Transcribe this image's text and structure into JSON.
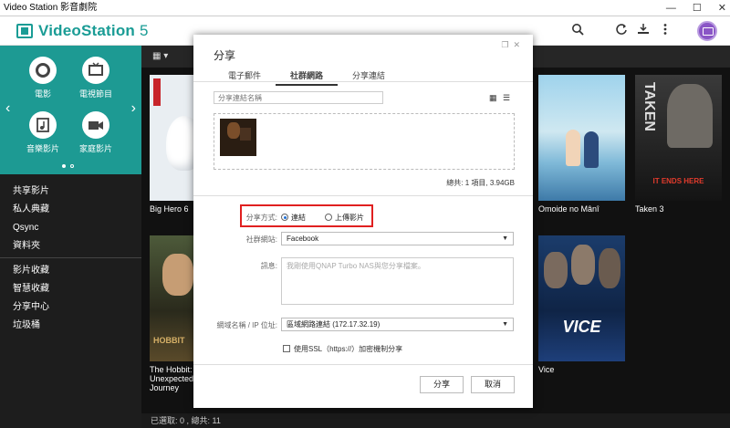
{
  "window": {
    "title": "Video Station 影音劇院",
    "controls": [
      "—",
      "☐",
      "✕"
    ]
  },
  "app": {
    "name": "VideoStation",
    "version": "5",
    "accent": "#1a9c95"
  },
  "sidebar": {
    "tiles": [
      {
        "label": "電影",
        "icon": "film-reel-icon"
      },
      {
        "label": "電視節目",
        "icon": "tv-icon"
      },
      {
        "label": "音樂影片",
        "icon": "music-note-icon"
      },
      {
        "label": "家庭影片",
        "icon": "camcorder-icon"
      }
    ],
    "section1": [
      "共享影片",
      "私人典藏",
      "Qsync",
      "資料夾"
    ],
    "section2": [
      "影片收藏",
      "智慧收藏",
      "分享中心",
      "垃圾桶"
    ]
  },
  "main": {
    "posters": [
      {
        "caption": "Big Hero 6"
      },
      {
        "caption": "Omoide no Mânî"
      },
      {
        "caption": "Taken 3"
      },
      {
        "caption": "The Hobbit: An Unexpected Journey"
      },
      {
        "caption": "Vice"
      }
    ],
    "status": "已選取: 0 , 總共: 11"
  },
  "dialog": {
    "title": "分享",
    "tabs": [
      "電子郵件",
      "社群網路",
      "分享連結"
    ],
    "active_tab": "社群網路",
    "search_placeholder": "分享連結名稱",
    "total": "總共: 1 項目, 3.94GB",
    "share_method_label": "分享方式:",
    "share_method_options": [
      "連結",
      "上傳影片"
    ],
    "share_method_selected": "連結",
    "social_label": "社群網站:",
    "social_value": "Facebook",
    "message_label": "訊息:",
    "message_placeholder": "我剛使用QNAP Turbo NAS與您分享檔案。",
    "domain_label": "網域名稱 / IP 位址:",
    "domain_value": "區域網路連結 (172.17.32.19)",
    "ssl_label": "使用SSL（https://）加密機制分享",
    "ssl_checked": false,
    "share_button": "分享",
    "cancel_button": "取消"
  }
}
